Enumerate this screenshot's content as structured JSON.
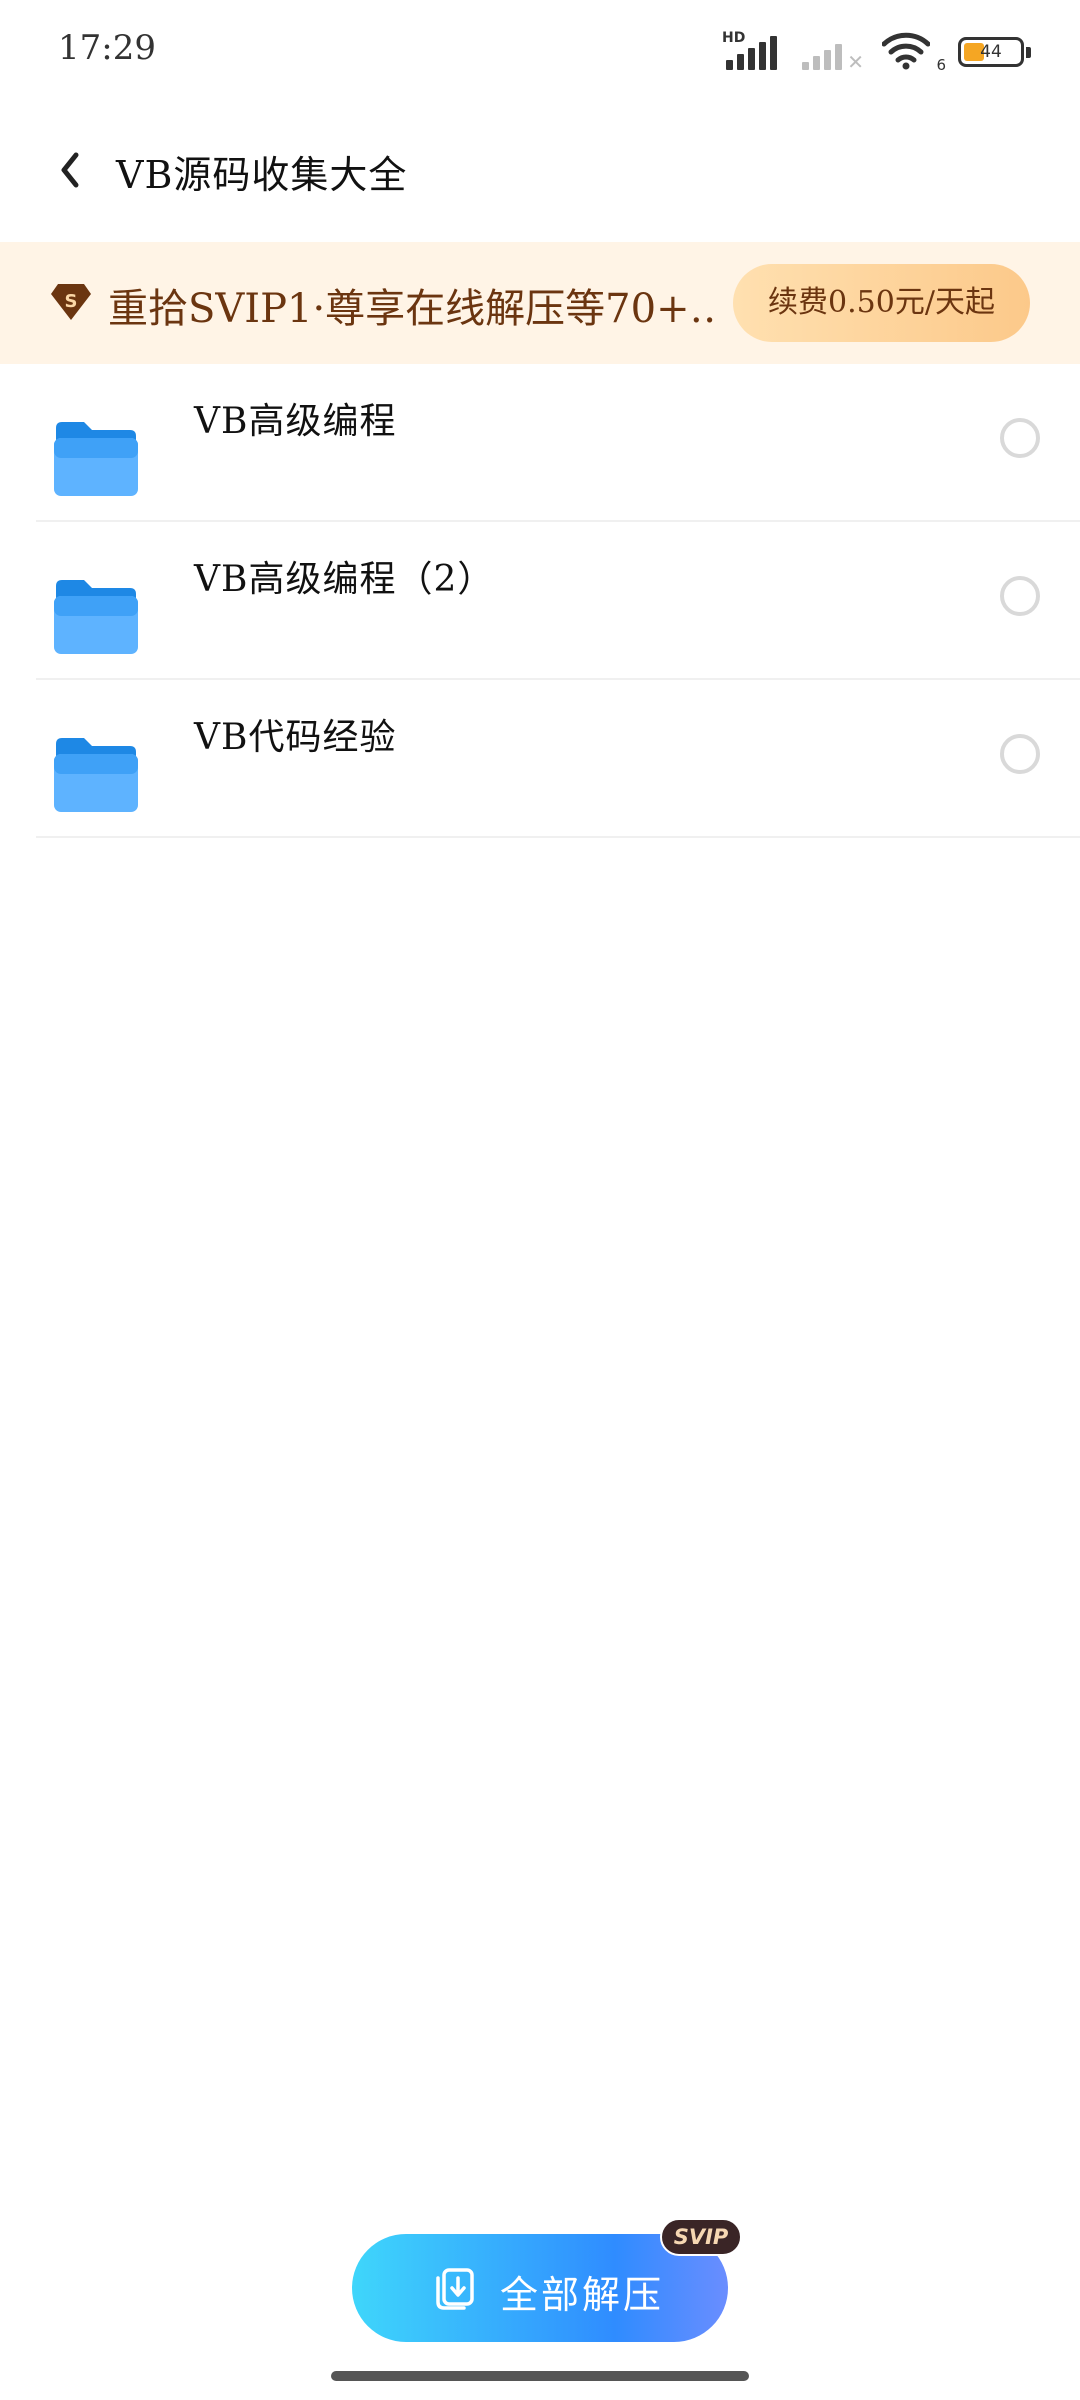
{
  "status_bar": {
    "time": "17:29",
    "hd_label": "HD",
    "wifi_label": "6",
    "battery_level": "44",
    "icons": [
      "signal-hd-icon",
      "signal-no-service-icon",
      "wifi-icon",
      "battery-icon"
    ]
  },
  "header": {
    "back_icon": "chevron-left-icon",
    "title": "VB源码收集大全"
  },
  "promo": {
    "icon": "svip-diamond-icon",
    "text": "重拾SVIP1·尊享在线解压等70+…",
    "button_label": "续费0.50元/天起",
    "colors": {
      "background": "#fff4e6",
      "text": "#6b3510",
      "button": "#fcc98a"
    }
  },
  "files": [
    {
      "name": "VB高级编程",
      "icon": "folder-icon",
      "selected": false
    },
    {
      "name": "VB高级编程（2）",
      "icon": "folder-icon",
      "selected": false
    },
    {
      "name": "VB代码经验",
      "icon": "folder-icon",
      "selected": false
    }
  ],
  "actions": {
    "extract_all_label": "全部解压",
    "extract_icon": "extract-archive-icon",
    "svip_badge": "SVIP",
    "accent_color": "#2f8cff"
  }
}
